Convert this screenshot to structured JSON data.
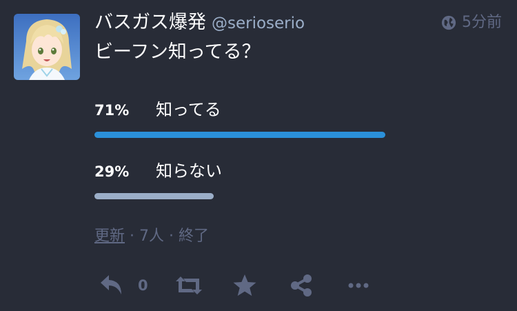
{
  "account": {
    "display_name": "バスガス爆発",
    "acct": "@serioserio",
    "avatar_icon": "avatar-anime-girl"
  },
  "meta": {
    "visibility_icon": "globe-icon",
    "time": "5分前"
  },
  "status": {
    "content": "ビーフン知ってる？"
  },
  "poll": {
    "options": [
      {
        "percent": "71%",
        "label": "知ってる",
        "fraction": 0.71,
        "color": "#2b90d9"
      },
      {
        "percent": "29%",
        "label": "知らない",
        "fraction": 0.29,
        "color": "#9baec8"
      }
    ],
    "refresh_label": "更新",
    "footer_rest": " · 7人 · 終了"
  },
  "actions": {
    "reply_count": "0",
    "reply_icon": "reply-icon",
    "boost_icon": "boost-icon",
    "favourite_icon": "star-icon",
    "share_icon": "share-icon",
    "more_icon": "ellipsis-icon"
  },
  "colors": {
    "background": "#282c37",
    "text_primary": "#ffffff",
    "text_secondary": "#9baec8",
    "text_muted": "#606984",
    "accent": "#2b90d9"
  }
}
